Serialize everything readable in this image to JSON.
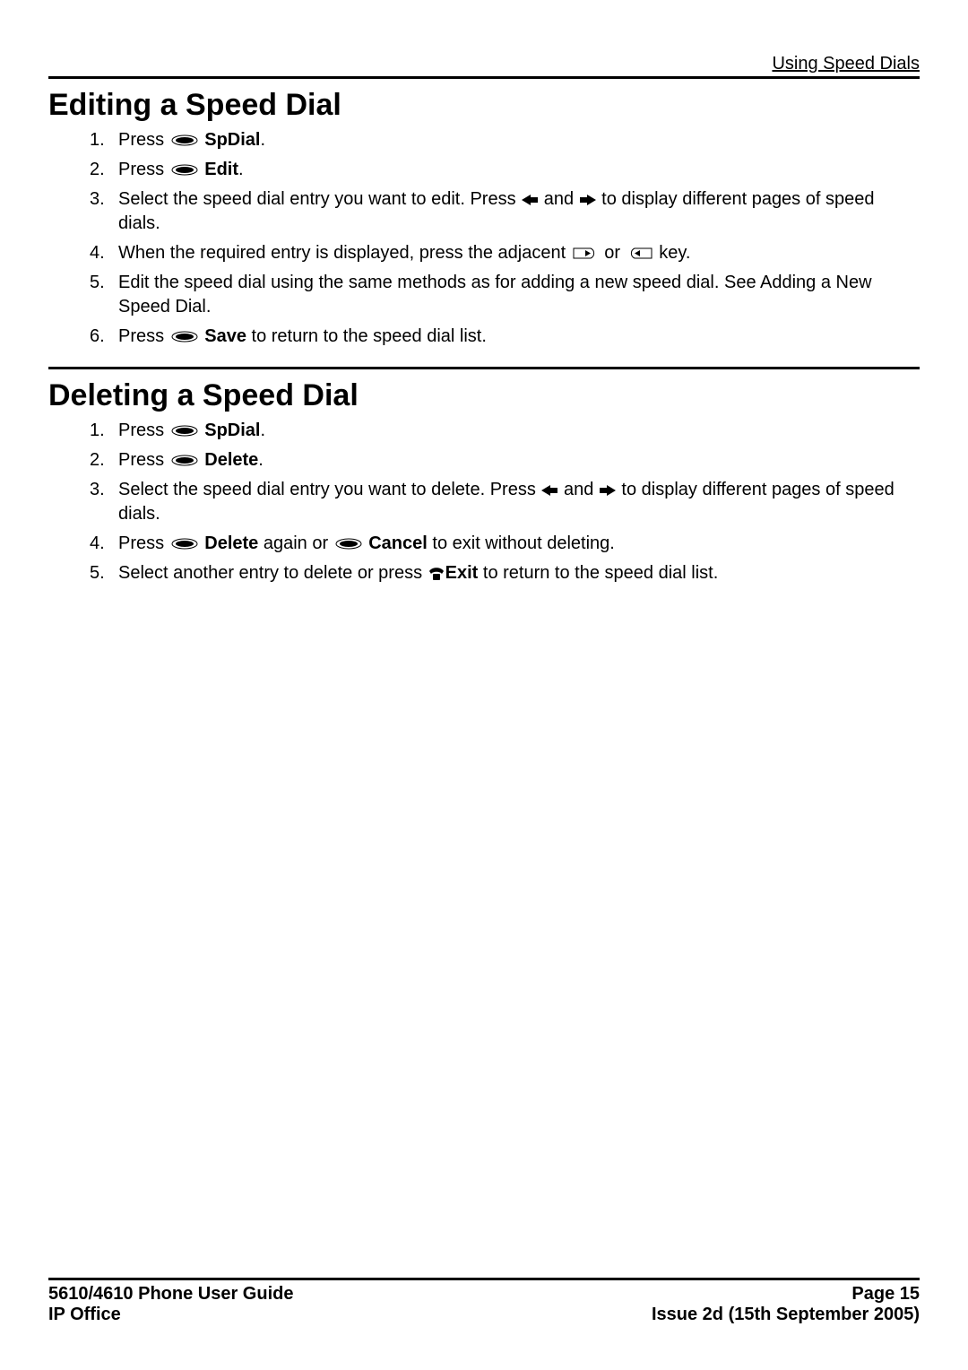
{
  "header": {
    "context": "Using Speed Dials"
  },
  "sections": {
    "edit": {
      "title": "Editing a Speed Dial",
      "steps": {
        "s1": {
          "t1": "Press ",
          "b1": "SpDial",
          "t2": "."
        },
        "s2": {
          "t1": "Press ",
          "b1": "Edit",
          "t2": "."
        },
        "s3": {
          "t1": "Select the speed dial entry you want to edit. Press ",
          "t2": " and ",
          "t3": " to display different pages of speed dials."
        },
        "s4": {
          "t1": "When the required entry is displayed, press the adjacent ",
          "t2": " or ",
          "t3": " key."
        },
        "s5": {
          "t1": "Edit the speed dial using the same methods as for adding a new speed dial. See Adding a New Speed Dial."
        },
        "s6": {
          "t1": "Press ",
          "b1": "Save",
          "t2": " to return to the speed dial list."
        }
      }
    },
    "delete": {
      "title": "Deleting a Speed Dial",
      "steps": {
        "s1": {
          "t1": "Press ",
          "b1": "SpDial",
          "t2": "."
        },
        "s2": {
          "t1": "Press ",
          "b1": "Delete",
          "t2": "."
        },
        "s3": {
          "t1": "Select the speed dial entry you want to delete. Press ",
          "t2": " and ",
          "t3": " to display different pages of speed dials."
        },
        "s4": {
          "t1": "Press ",
          "b1": "Delete",
          "t2": " again or ",
          "b2": "Cancel",
          "t3": " to exit without deleting."
        },
        "s5": {
          "t1": "Select another entry to delete or press ",
          "b1": "Exit",
          "t2": " to return to the speed dial list."
        }
      }
    }
  },
  "footer": {
    "left1": "5610/4610 Phone User Guide",
    "left2": "IP Office",
    "right1": "Page 15",
    "right2": "Issue 2d (15th September 2005)"
  }
}
